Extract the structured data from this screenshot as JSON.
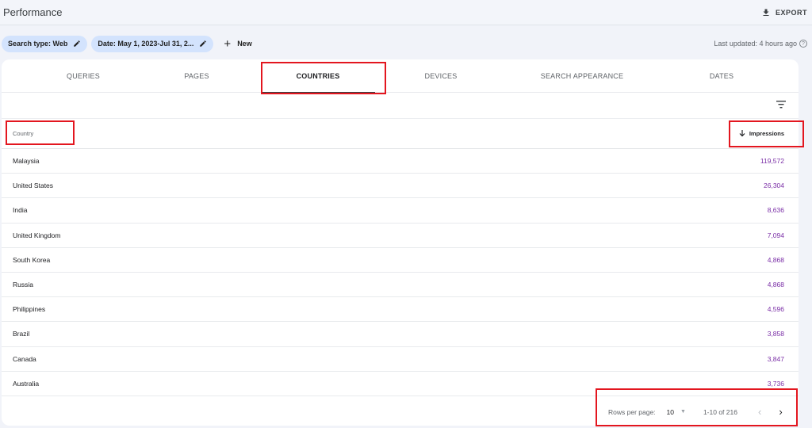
{
  "header": {
    "title": "Performance",
    "export_label": "EXPORT"
  },
  "filters": {
    "search_type": "Search type: Web",
    "date": "Date: May 1, 2023-Jul 31, 2...",
    "new_label": "New",
    "last_updated": "Last updated: 4 hours ago",
    "help_glyph": "?"
  },
  "tabs": [
    {
      "label": "QUERIES",
      "active": false
    },
    {
      "label": "PAGES",
      "active": false
    },
    {
      "label": "COUNTRIES",
      "active": true
    },
    {
      "label": "DEVICES",
      "active": false
    },
    {
      "label": "SEARCH APPEARANCE",
      "active": false
    },
    {
      "label": "DATES",
      "active": false
    }
  ],
  "table": {
    "col_country": "Country",
    "col_impressions": "Impressions",
    "sort_icon": "arrow-down-icon",
    "rows": [
      {
        "country": "Malaysia",
        "impressions": "119,572"
      },
      {
        "country": "United States",
        "impressions": "26,304"
      },
      {
        "country": "India",
        "impressions": "8,636"
      },
      {
        "country": "United Kingdom",
        "impressions": "7,094"
      },
      {
        "country": "South Korea",
        "impressions": "4,868"
      },
      {
        "country": "Russia",
        "impressions": "4,868"
      },
      {
        "country": "Philippines",
        "impressions": "4,596"
      },
      {
        "country": "Brazil",
        "impressions": "3,858"
      },
      {
        "country": "Canada",
        "impressions": "3,847"
      },
      {
        "country": "Australia",
        "impressions": "3,736"
      }
    ]
  },
  "pagination": {
    "rows_per_page_label": "Rows per page:",
    "rows_per_page_value": "10",
    "range": "1-10 of 216"
  },
  "colors": {
    "chip_bg": "#d3e3fd",
    "value_text": "#7a2ea6",
    "highlight": "#e3161f"
  }
}
